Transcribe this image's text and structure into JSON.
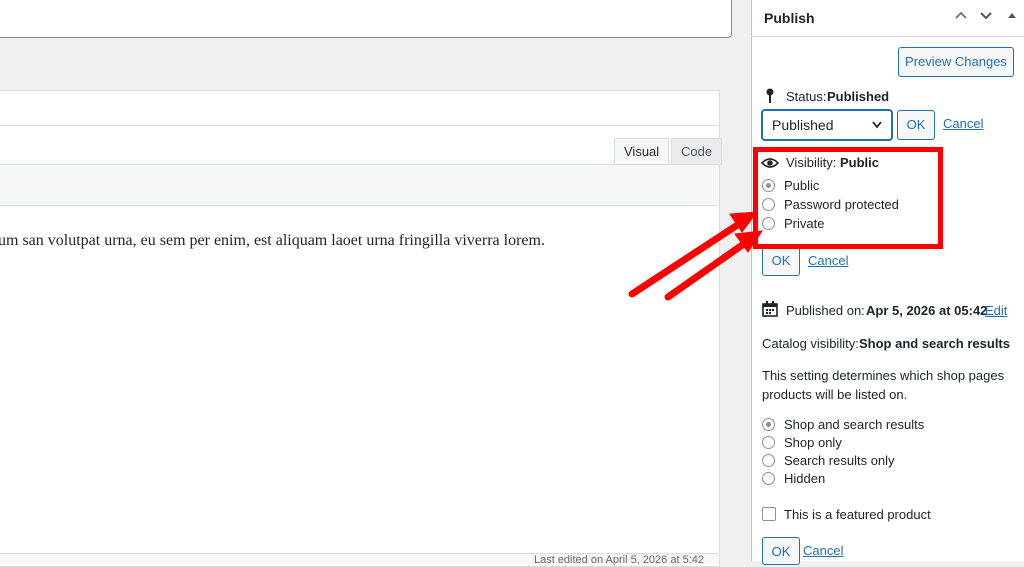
{
  "editor": {
    "tab_visual": "Visual",
    "tab_code": "Code",
    "content_text": "um san volutpat urna, eu sem per enim, est aliquam laoet urna fringilla viverra lorem.",
    "last_edited": "Last edited on April 5, 2026 at 5:42"
  },
  "publish": {
    "title": "Publish",
    "header_up_icon": "chevron-up-icon",
    "header_down_icon": "chevron-down-icon",
    "header_toggle_icon": "triangle-up-icon",
    "preview_button": "Preview Changes",
    "status_label": "Status:",
    "status_value": "Published",
    "status_select_value": "Published",
    "ok_label": "OK",
    "cancel_label": "Cancel",
    "visibility_label": "Visibility:",
    "visibility_value": "Public",
    "visibility_options": [
      "Public",
      "Password protected",
      "Private"
    ],
    "visibility_selected": "Public",
    "published_on_label": "Published on:",
    "published_on_value": "Apr 5, 2026 at 05:42",
    "edit_label": "Edit",
    "catalog_label": "Catalog visibility:",
    "catalog_value": "Shop and search results",
    "catalog_help": "This setting determines which shop pages products will be listed on.",
    "catalog_help_line1": "This setting determines which shop pages",
    "catalog_help_line2": "products will be listed on.",
    "catalog_options": [
      "Shop and search results",
      "Shop only",
      "Search results only",
      "Hidden"
    ],
    "catalog_selected": "Shop and search results",
    "featured_label": "This is a featured product",
    "featured_checked": false
  },
  "annotation": {
    "highlight_color": "#ff0000",
    "arrow_color": "#ff0000"
  },
  "colors": {
    "accent": "#2271b1",
    "background": "#f0f0f1"
  }
}
